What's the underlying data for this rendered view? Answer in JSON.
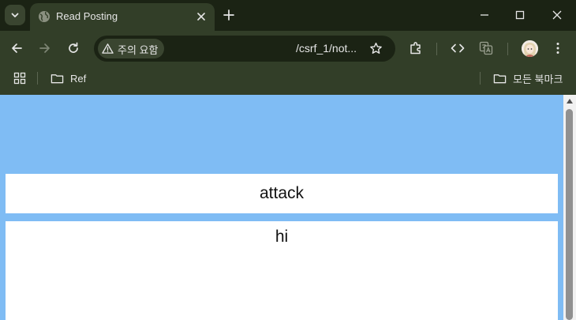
{
  "browser": {
    "tab": {
      "title": "Read Posting"
    },
    "omnibox": {
      "security_label": "주의 요함",
      "url": "/csrf_1/not..."
    },
    "bookmarks": {
      "folder_label": "Ref",
      "all_bookmarks_label": "모든 북마크"
    },
    "theme": {
      "tabstrip_bg": "#1b2314",
      "toolbar_bg": "#323e28",
      "icon_color": "#e6e6e6"
    }
  },
  "page": {
    "background": "#7fbcf4",
    "post": {
      "title": "attack",
      "body": "hi"
    }
  }
}
